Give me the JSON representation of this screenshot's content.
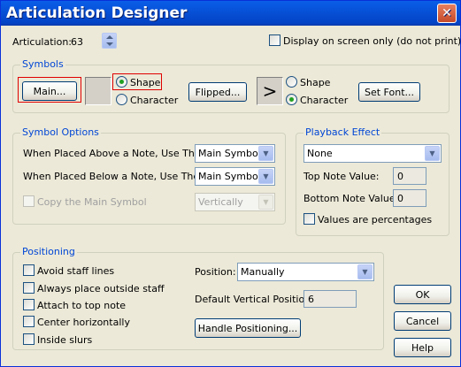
{
  "window": {
    "title": "Articulation Designer",
    "close_glyph": "✕"
  },
  "articulation": {
    "label": "Articulation:",
    "value": "63"
  },
  "display_on_screen": {
    "label": "Display on screen only (do not print)",
    "checked": false
  },
  "symbols": {
    "title": "Symbols",
    "main_button": "Main...",
    "main_radio_shape": "Shape",
    "main_radio_character": "Character",
    "main_selected": "Shape",
    "flipped_button": "Flipped...",
    "flipped_preview": ">",
    "flipped_radio_shape": "Shape",
    "flipped_radio_character": "Character",
    "flipped_selected": "Character",
    "set_font_button": "Set Font..."
  },
  "symbol_options": {
    "title": "Symbol Options",
    "above_label": "When Placed Above a Note, Use The:",
    "above_value": "Main Symbol",
    "below_label": "When Placed Below a Note, Use The:",
    "below_value": "Main Symbol",
    "copy_label": "Copy the Main Symbol",
    "copy_value": "Vertically"
  },
  "playback": {
    "title": "Playback Effect",
    "effect_value": "None",
    "top_label": "Top Note Value:",
    "top_value": "0",
    "bottom_label": "Bottom Note Value:",
    "bottom_value": "0",
    "percent_label": "Values are percentages"
  },
  "positioning": {
    "title": "Positioning",
    "checks": [
      "Avoid staff lines",
      "Always place outside staff",
      "Attach to top note",
      "Center horizontally",
      "Inside slurs"
    ],
    "position_label": "Position:",
    "position_value": "Manually",
    "default_vertical_label": "Default Vertical Position:",
    "default_vertical_value": "6",
    "handle_button": "Handle Positioning..."
  },
  "buttons": {
    "ok": "OK",
    "cancel": "Cancel",
    "help": "Help"
  }
}
